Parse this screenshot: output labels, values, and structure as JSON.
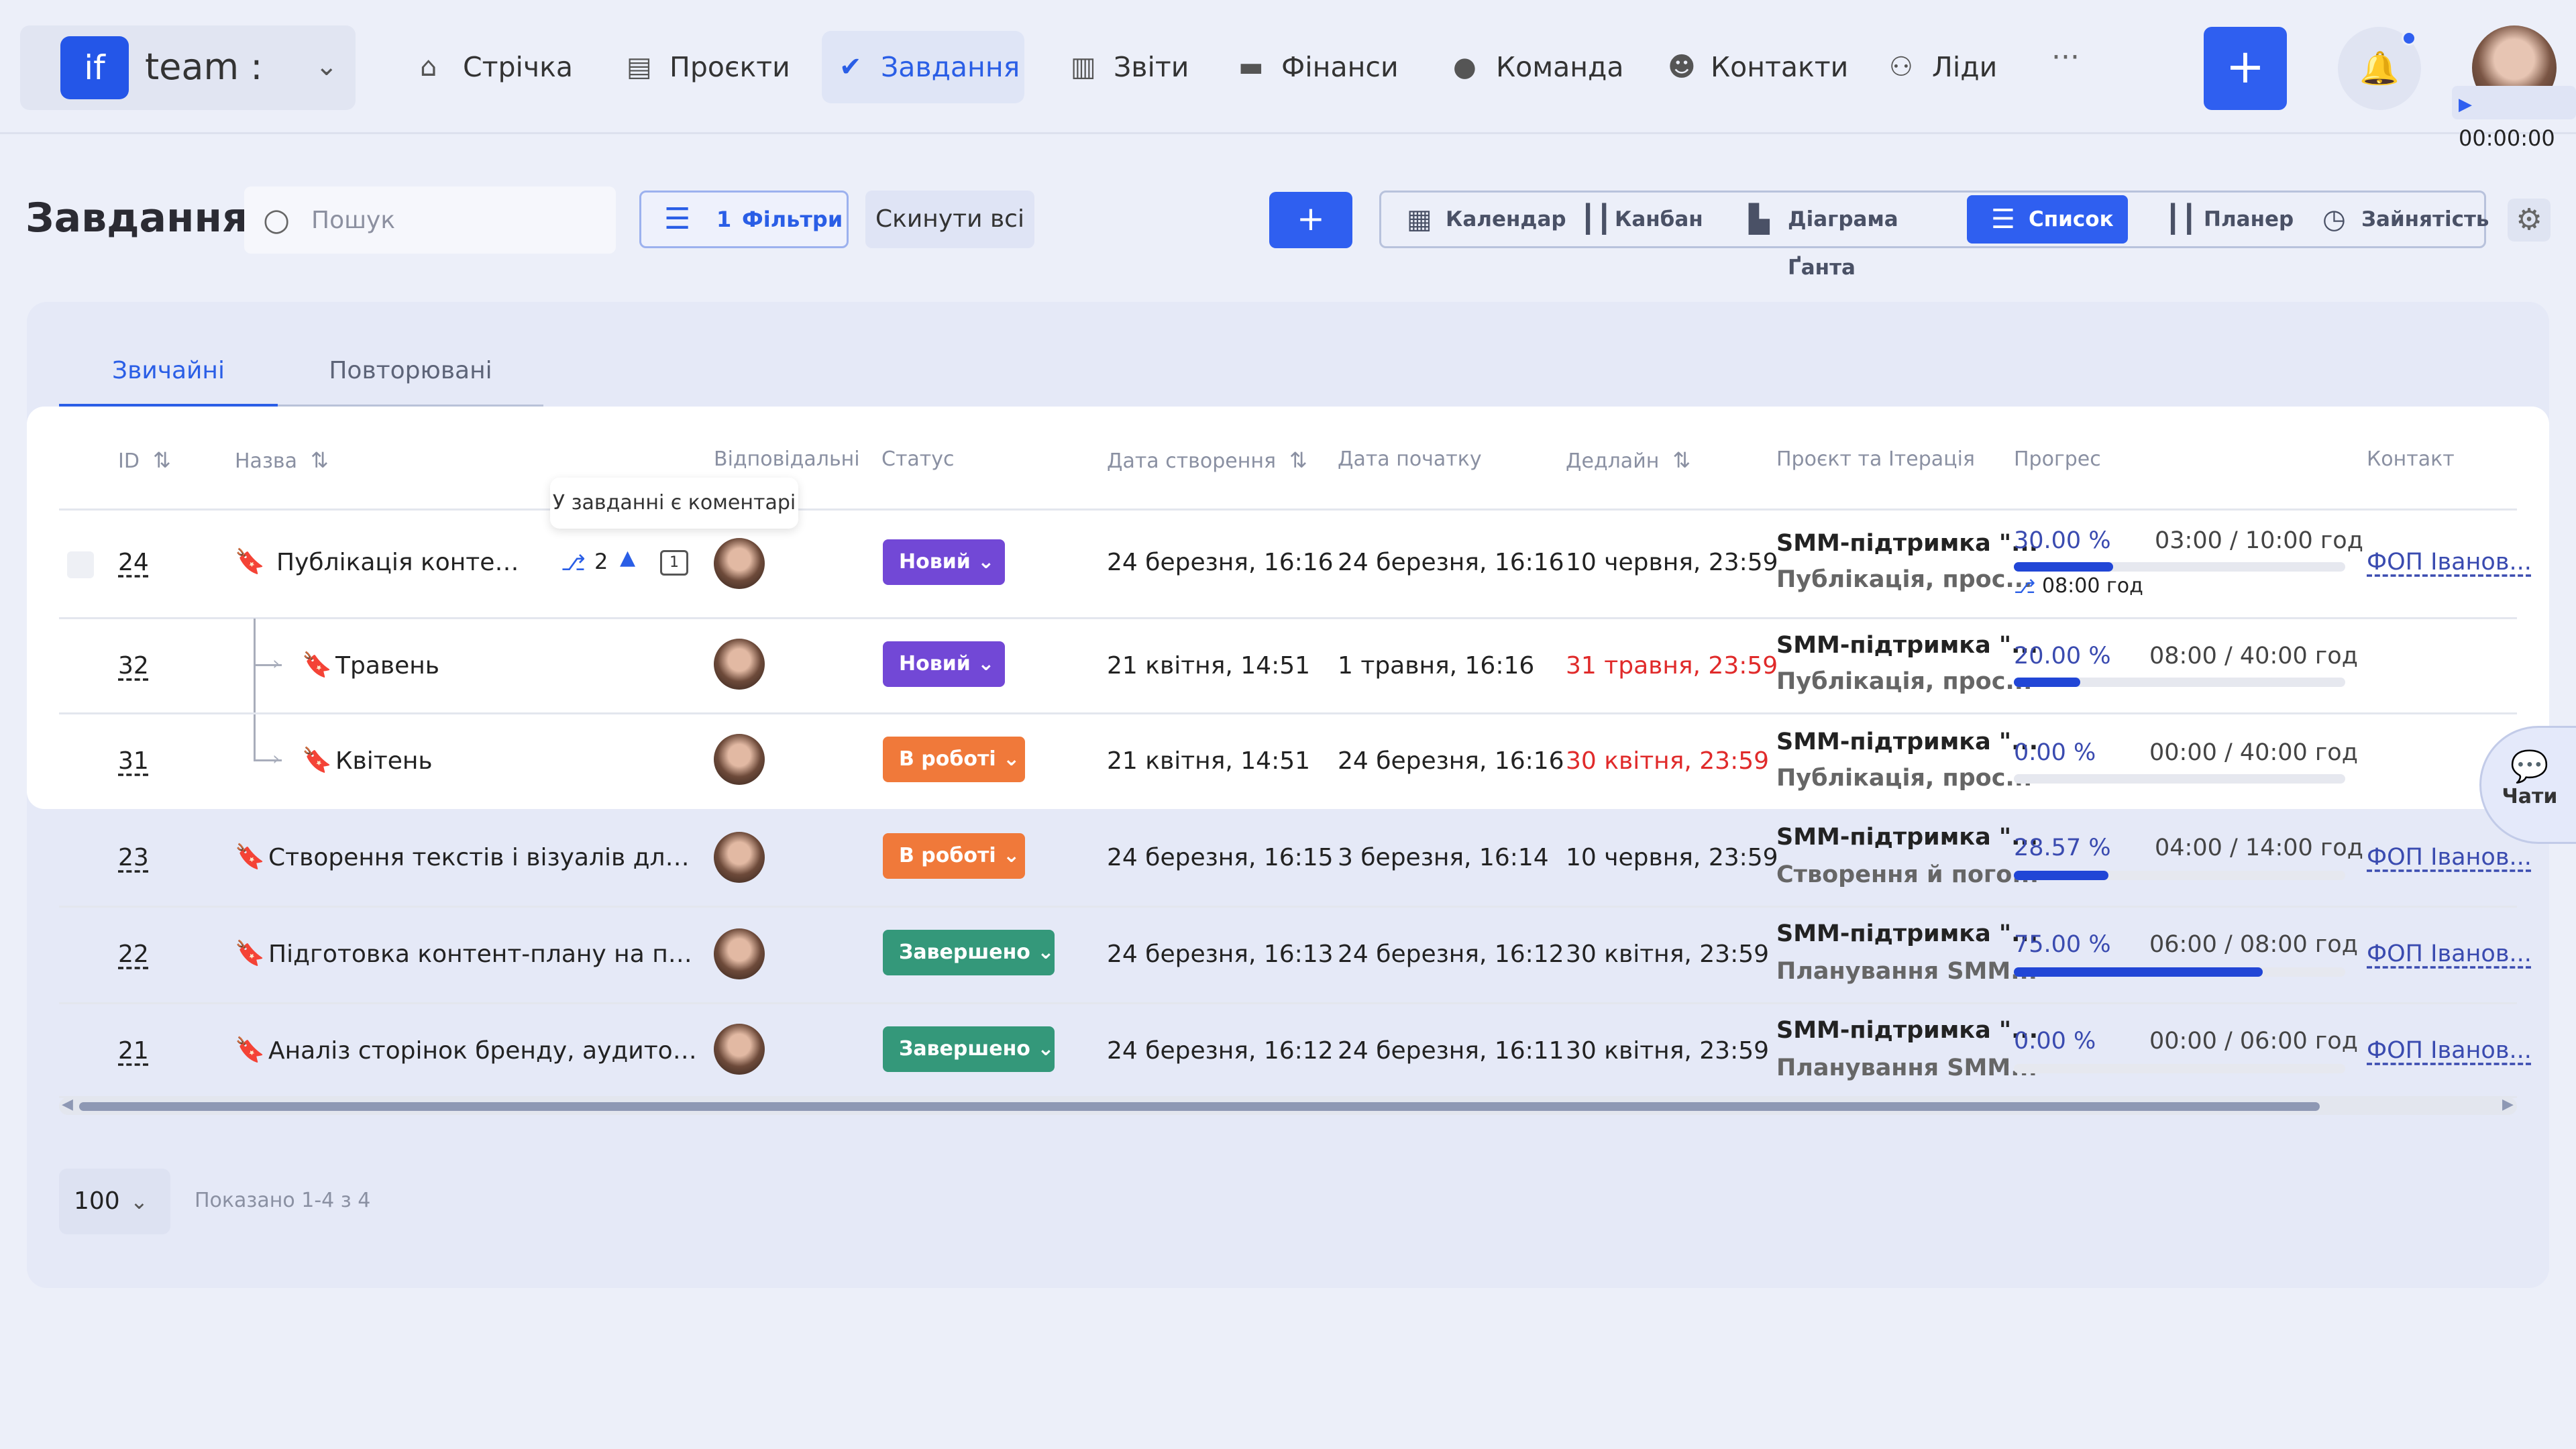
{
  "brand": {
    "logo": "if",
    "name": "team :"
  },
  "nav": [
    {
      "label": "Стрічка",
      "icon": "home-icon"
    },
    {
      "label": "Проєкти",
      "icon": "document-icon"
    },
    {
      "label": "Завдання",
      "icon": "check-circle-icon",
      "active": true
    },
    {
      "label": "Звіти",
      "icon": "chart-icon"
    },
    {
      "label": "Фінанси",
      "icon": "wallet-icon"
    },
    {
      "label": "Команда",
      "icon": "person-icon"
    },
    {
      "label": "Контакти",
      "icon": "contacts-icon"
    },
    {
      "label": "Ліди",
      "icon": "leads-icon"
    }
  ],
  "more": "···",
  "timer": "00:00:00",
  "page": {
    "title": "Завдання"
  },
  "search": {
    "placeholder": "Пошук"
  },
  "filters": {
    "count": "1",
    "label": "Фільтри"
  },
  "reset_label": "Скинути всі",
  "add_label": "+",
  "views": [
    {
      "label": "Календар",
      "icon": "calendar-icon"
    },
    {
      "label": "Канбан",
      "icon": "kanban-icon"
    },
    {
      "label": "Діаграма Ґанта",
      "icon": "gantt-icon"
    },
    {
      "label": "Список",
      "icon": "list-icon",
      "active": true
    },
    {
      "label": "Планер",
      "icon": "planner-icon"
    },
    {
      "label": "Зайнятість",
      "icon": "clock-icon"
    }
  ],
  "tabs": {
    "regular": "Звичайні",
    "recurring": "Повторювані"
  },
  "columns": {
    "id": "ID",
    "name": "Назва",
    "assignees": "Відповідальні",
    "status": "Статус",
    "created": "Дата створення",
    "start": "Дата початку",
    "deadline": "Дедлайн",
    "project": "Проєкт та Ітерація",
    "progress": "Прогрес",
    "contact": "Контакт"
  },
  "tooltip": "У завданні є коментарі",
  "rows": [
    {
      "id": "24",
      "name": "Публікація контенту ...",
      "flag_color": "#f07a2c",
      "subtasks": "2",
      "comments": "1",
      "status": "Новий",
      "created": "24 березня, 16:16",
      "start": "24 березня, 16:16",
      "deadline": "10 червня, 23:59",
      "project": "SMM-підтримка \"...",
      "iteration": "Публікація, прос...",
      "percent": "30.00 %",
      "progress": 0.3,
      "hours": "03:00 / 10:00 год",
      "tracked": "08:00 год",
      "contact": "ФОП Іванов..."
    },
    {
      "id": "32",
      "name": "Травень",
      "flag_color": "#f07a2c",
      "status": "Новий",
      "created": "21 квітня, 14:51",
      "start": "1 травня, 16:16",
      "deadline": "31 травня, 23:59",
      "late": true,
      "project": "SMM-підтримка \"...",
      "iteration": "Публікація, прос...",
      "percent": "20.00 %",
      "progress": 0.2,
      "hours": "08:00 / 40:00 год"
    },
    {
      "id": "31",
      "name": "Квітень",
      "flag_color": "#ef5a5a",
      "status": "В роботі",
      "created": "21 квітня, 14:51",
      "start": "24 березня, 16:16",
      "deadline": "30 квітня, 23:59",
      "late": true,
      "project": "SMM-підтримка \"...",
      "iteration": "Публікація, прос...",
      "percent": "0.00 %",
      "progress": 0,
      "hours": "00:00 / 40:00 год"
    },
    {
      "id": "23",
      "name": "Створення текстів і візуалів для пуб...",
      "flag_color": "#ef6a6a",
      "status": "В роботі",
      "created": "24 березня, 16:15",
      "start": "3 березня, 16:14",
      "deadline": "10 червня, 23:59",
      "project": "SMM-підтримка \"...",
      "iteration": "Створення й пого...",
      "percent": "28.57 %",
      "progress": 0.2857,
      "hours": "04:00 / 14:00 год",
      "contact": "ФОП Іванов..."
    },
    {
      "id": "22",
      "name": "Підготовка контент-плану на період",
      "flag_color": "#2456e8",
      "status": "Завершено",
      "created": "24 березня, 16:13",
      "start": "24 березня, 16:12",
      "deadline": "30 квітня, 23:59",
      "project": "SMM-підтримка \"...",
      "iteration": "Планування SMM...",
      "percent": "75.00 %",
      "progress": 0.75,
      "hours": "06:00 / 08:00 год",
      "contact": "ФОП Іванов..."
    },
    {
      "id": "21",
      "name": "Аналіз сторінок бренду, аудиторії та...",
      "flag_color": "#f07a2c",
      "status": "Завершено",
      "created": "24 березня, 16:12",
      "start": "24 березня, 16:11",
      "deadline": "30 квітня, 23:59",
      "project": "SMM-підтримка \"...",
      "iteration": "Планування SMM...",
      "percent": "0.00 %",
      "progress": 0,
      "hours": "00:00 / 06:00 год",
      "contact": "ФОП Іванов..."
    }
  ],
  "pagination": {
    "per_page": "100",
    "shown": "Показано 1-4 з 4"
  },
  "chats_label": "Чати",
  "colors": {
    "accent": "#2f5ff0",
    "new": "#7248d6",
    "in_progress": "#f0793a",
    "done": "#34987a",
    "late": "#e02a2a"
  }
}
